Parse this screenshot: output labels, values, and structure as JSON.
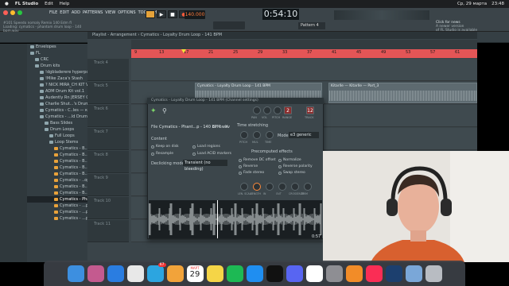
{
  "menubar": {
    "app": "FL Studio",
    "items": [
      "Edit",
      "Help"
    ],
    "date": "Ср, 29 марта",
    "time": "23:48"
  },
  "fl": {
    "menu": [
      "FILE",
      "EDIT",
      "ADD",
      "PATTERNS",
      "VIEW",
      "OPTIONS",
      "TOOLS",
      "HELP"
    ],
    "hint_line1": "#101 Speedo nomaly Remix 140 Edm fl",
    "hint_line2": "Loading: cymatics - phantom drum loop - 140 bpm.wav",
    "tempo": "140.000",
    "clock": "0:54:10",
    "pattern": "Pattern 4",
    "news_line1": "Click for news",
    "news_line2": "A newer version",
    "news_line3": "of FL Studio is available"
  },
  "browser": {
    "items": [
      {
        "label": "Envelopes",
        "kind": "folder",
        "indent": 0
      },
      {
        "label": "FL",
        "kind": "folder",
        "indent": 0
      },
      {
        "label": "CRC",
        "kind": "folder",
        "indent": 1
      },
      {
        "label": "Drum kits",
        "kind": "folder",
        "indent": 1
      },
      {
        "label": "!dgbladerere hyperpop",
        "kind": "folder",
        "indent": 2
      },
      {
        "label": "!Mike Zaca's Stash",
        "kind": "folder",
        "indent": 2
      },
      {
        "label": "? NICK MIRA_CH KIT VOL 1",
        "kind": "folder",
        "indent": 2
      },
      {
        "label": "ADM Drum Kit vol.1",
        "kind": "folder",
        "indent": 2
      },
      {
        "label": "Audently Rn JERSEY CLUB",
        "kind": "folder",
        "indent": 2
      },
      {
        "label": "Charlie Shut...'s Drum Kit",
        "kind": "folder",
        "indent": 2
      },
      {
        "label": "Cymatics - C..les — копия",
        "kind": "folder",
        "indent": 2
      },
      {
        "label": "Cymatics - ...ld Drum Kit",
        "kind": "folder",
        "indent": 2
      },
      {
        "label": "Bass Slides",
        "kind": "folder",
        "indent": 3
      },
      {
        "label": "Drum Loops",
        "kind": "folder",
        "indent": 3
      },
      {
        "label": "Full Loops",
        "kind": "folder",
        "indent": 4
      },
      {
        "label": "Loop Stems",
        "kind": "folder",
        "indent": 4
      },
      {
        "label": "Cymatics - B..p - 140 BPM",
        "kind": "file",
        "indent": 5
      },
      {
        "label": "Cymatics - B..p - 140 BPM",
        "kind": "file",
        "indent": 5
      },
      {
        "label": "Cymatics - B..p - 140 BPM",
        "kind": "file",
        "indent": 5
      },
      {
        "label": "Cymatics - B..p - 140 BPM",
        "kind": "file",
        "indent": 5
      },
      {
        "label": "Cymatics - B..p - 140 BPM",
        "kind": "file",
        "indent": 5
      },
      {
        "label": "Cymatics - ..op - 157 BPM",
        "kind": "file",
        "indent": 5
      },
      {
        "label": "Cymatics - B..p - 140 BPM",
        "kind": "file",
        "indent": 5
      },
      {
        "label": "Cymatics - B..p - 140 BPM",
        "kind": "file",
        "indent": 5
      },
      {
        "label": "Cymatics - Phantom Drum Loop - 140 BPM",
        "kind": "file",
        "indent": 5,
        "selected": true
      },
      {
        "label": "Cymatics - ...p - 140 BPM",
        "kind": "file",
        "indent": 5
      },
      {
        "label": "Cymatics - ...p - 140 BPM",
        "kind": "file",
        "indent": 5
      },
      {
        "label": "Cymatics - ...p - 140 BPM",
        "kind": "file",
        "indent": 5
      }
    ]
  },
  "playlist": {
    "title": "Playlist - Arrangement › Cymatics - Loyalty Drum Loop - 141 BPM",
    "bars": [
      "9",
      "13",
      "17",
      "21",
      "25",
      "29",
      "33",
      "37",
      "41",
      "45",
      "49",
      "53",
      "57",
      "61"
    ],
    "tracks": [
      "Track 4",
      "Track 5",
      "Track 6",
      "Track 7",
      "Track 8",
      "Track 9",
      "Track 10",
      "Track 11"
    ],
    "clips": [
      {
        "label": "Cymatics - Loyalty Drum Loop - 141 BPM",
        "track": 1
      },
      {
        "label": "Kitarlle — Kitarlle — Part_3",
        "track": 1
      },
      {
        "label": "Cymatics - L... 141 BPM",
        "track": 5
      },
      {
        "label": "Cymatics - 141 BPM",
        "track": 5
      },
      {
        "label": "Cym",
        "track": 5
      }
    ]
  },
  "channel_settings": {
    "titlebar": "Cymatics - Loyalty Drum Loop - 141 BPM  (Channel settings)",
    "file_label": "File",
    "file_name": "Cymatics - Phant...p - 140 BPM.wav",
    "knob_labels": [
      "PAN",
      "VOL",
      "PITCH",
      "RANGE",
      "TRACK"
    ],
    "range_value": "2",
    "track_value": "12",
    "content_label": "Content",
    "content_opts": [
      "Keep on disk",
      "Load regions",
      "Resample",
      "Load ACID markers"
    ],
    "declicking_label": "Declicking mode",
    "declicking_value": "Transient (no bleeding)",
    "time_stretch_label": "Time stretching",
    "ts_knob_labels": [
      "PITCH",
      "MUL",
      "TIME"
    ],
    "mode_label": "Mode",
    "mode_value": "e3 generic",
    "precomputed_label": "Precomputed effects",
    "effects": [
      "Remove DC offset",
      "Normalize",
      "Reverse",
      "Reverse polarity",
      "Fade stereo",
      "Swap stereo"
    ],
    "fx_knob_labels": [
      "LEN. SCALE",
      "LENGTH",
      "IN",
      "OUT",
      "CROSSFADE",
      "TRIM"
    ],
    "waveform_time": "0:57"
  },
  "dock": {
    "apps": [
      "finder",
      "launchpad",
      "safari",
      "chrome",
      "telegram",
      "photos",
      "calendar",
      "notes",
      "spotify",
      "app-store",
      "capcut",
      "discord",
      "notion",
      "settings",
      "fl-studio",
      "music",
      "photoshop",
      "downloads",
      "trash"
    ],
    "calendar_month": "МАРТ",
    "calendar_day": "29",
    "telegram_badge": "67"
  },
  "colors": {
    "accent": "#e45556",
    "fl_orange": "#ff7a3a",
    "panel": "#3c464b",
    "clip": "#5d6a70"
  }
}
